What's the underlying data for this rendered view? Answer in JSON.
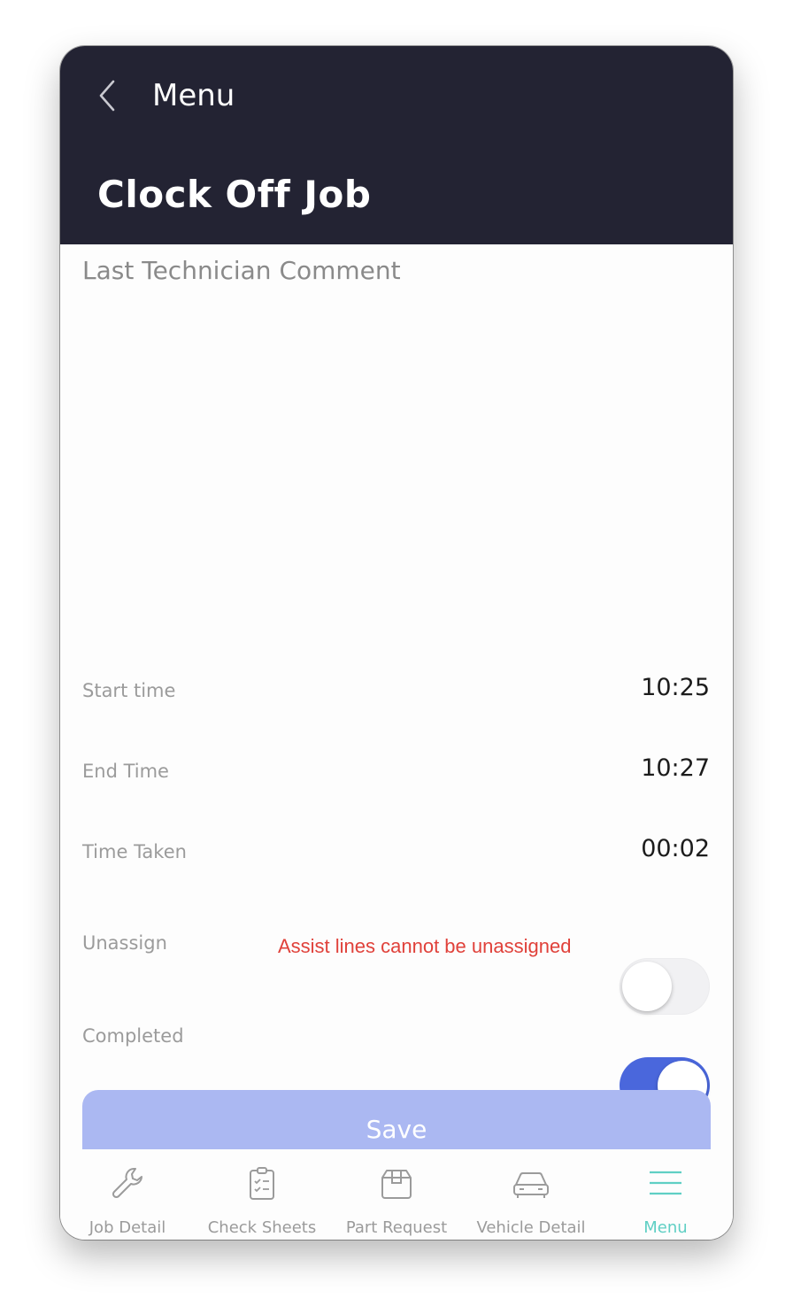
{
  "header": {
    "back_label": "Menu",
    "title": "Clock Off Job"
  },
  "comment": {
    "label": "Last Technician Comment"
  },
  "rows": {
    "start_time": {
      "label": "Start time",
      "value": "10:25"
    },
    "end_time": {
      "label": "End Time",
      "value": "10:27"
    },
    "time_taken": {
      "label": "Time Taken",
      "value": "00:02"
    },
    "unassign": {
      "label": "Unassign",
      "warning": "Assist lines cannot be unassigned",
      "checked": false
    },
    "completed": {
      "label": "Completed",
      "checked": true
    }
  },
  "save_label": "Save",
  "tabs": [
    {
      "label": "Job Detail",
      "icon": "wrench-icon"
    },
    {
      "label": "Check Sheets",
      "icon": "clipboard-check-icon"
    },
    {
      "label": "Part Request",
      "icon": "package-icon"
    },
    {
      "label": "Vehicle Detail",
      "icon": "car-icon"
    },
    {
      "label": "Menu",
      "icon": "hamburger-menu-icon",
      "active": true
    }
  ],
  "colors": {
    "header_bg": "#232333",
    "toggle_on": "#4a67dc",
    "save_button": "#abb8f2",
    "warning_text": "#e0413a",
    "active_tab": "#5fcfc4"
  }
}
